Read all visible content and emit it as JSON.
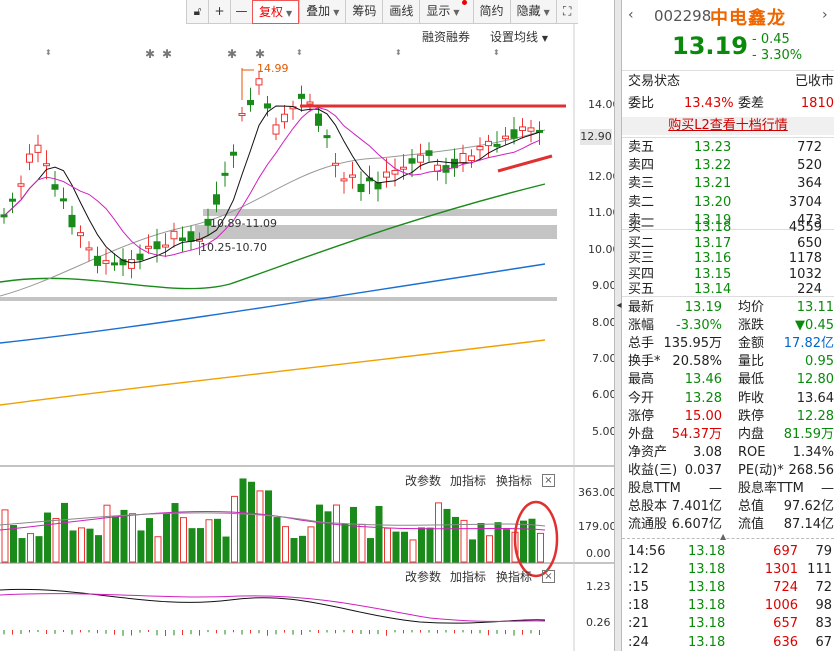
{
  "toolbar": {
    "buttons": [
      "+",
      "—"
    ],
    "fuquan": "复权",
    "diejia": "叠加",
    "chouma": "筹码",
    "huaxian": "画线",
    "xianshi": "显示",
    "jianyue": "简约",
    "yincang": "隐藏"
  },
  "main_chart": {
    "rzrq": "融资融券",
    "set_ma": "设置均线",
    "high_label": "14.99",
    "zone1_label": "10.89-11.09",
    "zone2_label": "10.25-10.70",
    "current_price_tag": "12.90",
    "y_ticks": [
      "14.00",
      "13.00",
      "12.00",
      "11.00",
      "10.00",
      "9.00",
      "8.00",
      "7.00",
      "6.00",
      "5.00"
    ]
  },
  "vol_panel": {
    "gai": "改参数",
    "jia": "加指标",
    "huan": "换指标",
    "y_ticks": [
      "363.00",
      "179.00",
      "0.00"
    ]
  },
  "macd_panel": {
    "gai": "改参数",
    "jia": "加指标",
    "huan": "换指标",
    "y_ticks": [
      "1.23",
      "0.26"
    ]
  },
  "stock": {
    "code": "002298",
    "name": "中电鑫龙",
    "price": "13.19",
    "change": "- 0.45",
    "change_pct": "- 3.30%"
  },
  "status": {
    "label": "交易状态",
    "value": "已收市"
  },
  "weibi": {
    "label": "委比",
    "value": "13.43%",
    "label2": "委差",
    "value2": "1810"
  },
  "l2_link": "购买L2查看十档行情",
  "asks": [
    {
      "label": "卖五",
      "price": "13.23",
      "vol": "772"
    },
    {
      "label": "卖四",
      "price": "13.22",
      "vol": "520"
    },
    {
      "label": "卖三",
      "price": "13.21",
      "vol": "364"
    },
    {
      "label": "卖二",
      "price": "13.20",
      "vol": "3704"
    },
    {
      "label": "卖一",
      "price": "13.19",
      "vol": "473"
    }
  ],
  "bids": [
    {
      "label": "买一",
      "price": "13.18",
      "vol": "4559"
    },
    {
      "label": "买二",
      "price": "13.17",
      "vol": "650"
    },
    {
      "label": "买三",
      "price": "13.16",
      "vol": "1178"
    },
    {
      "label": "买四",
      "price": "13.15",
      "vol": "1032"
    },
    {
      "label": "买五",
      "price": "13.14",
      "vol": "224"
    }
  ],
  "stats": [
    {
      "l1": "最新",
      "v1": "13.19",
      "c1": "green",
      "l2": "均价",
      "v2": "13.11",
      "c2": "green"
    },
    {
      "l1": "涨幅",
      "v1": "-3.30%",
      "c1": "green",
      "l2": "涨跌",
      "v2": "▼0.45",
      "c2": "green"
    },
    {
      "l1": "总手",
      "v1": "135.95万",
      "c1": "dark",
      "l2": "金额",
      "v2": "17.82亿",
      "c2": "blue"
    },
    {
      "l1": "换手*",
      "v1": "20.58%",
      "c1": "dark",
      "l2": "量比",
      "v2": "0.95",
      "c2": "green"
    },
    {
      "l1": "最高",
      "v1": "13.46",
      "c1": "green",
      "l2": "最低",
      "v2": "12.80",
      "c2": "green"
    },
    {
      "l1": "今开",
      "v1": "13.28",
      "c1": "green",
      "l2": "昨收",
      "v2": "13.64",
      "c2": "dark"
    },
    {
      "l1": "涨停",
      "v1": "15.00",
      "c1": "red",
      "l2": "跌停",
      "v2": "12.28",
      "c2": "green"
    },
    {
      "l1": "外盘",
      "v1": "54.37万",
      "c1": "red",
      "l2": "内盘",
      "v2": "81.59万",
      "c2": "green"
    },
    {
      "l1": "净资产",
      "v1": "3.08",
      "c1": "dark",
      "l2": "ROE",
      "v2": "1.34%",
      "c2": "dark"
    },
    {
      "l1": "收益(三)",
      "v1": "0.037",
      "c1": "dark",
      "l2": "PE(动)*",
      "v2": "268.56",
      "c2": "dark"
    },
    {
      "l1": "股息TTM",
      "v1": "—",
      "c1": "dark",
      "l2": "股息率TTM",
      "v2": "—",
      "c2": "dark"
    },
    {
      "l1": "总股本",
      "v1": "7.401亿",
      "c1": "dark",
      "l2": "总值",
      "v2": "97.62亿",
      "c2": "dark"
    },
    {
      "l1": "流通股",
      "v1": "6.607亿",
      "c1": "dark",
      "l2": "流值",
      "v2": "87.14亿",
      "c2": "dark"
    }
  ],
  "ticks": [
    {
      "time": "14:56",
      "price": "13.18",
      "vol": "697",
      "n": "79"
    },
    {
      "time": ":12",
      "price": "13.18",
      "vol": "1301",
      "n": "111"
    },
    {
      "time": ":15",
      "price": "13.18",
      "vol": "724",
      "n": "72"
    },
    {
      "time": ":18",
      "price": "13.18",
      "vol": "1006",
      "n": "98"
    },
    {
      "time": ":21",
      "price": "13.18",
      "vol": "657",
      "n": "83"
    },
    {
      "time": ":24",
      "price": "13.18",
      "vol": "636",
      "n": "67"
    }
  ]
}
